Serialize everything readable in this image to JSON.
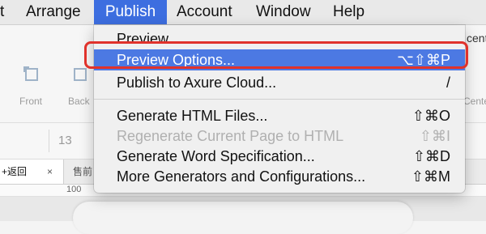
{
  "menubar": {
    "items": [
      {
        "label": "t"
      },
      {
        "label": "Arrange"
      },
      {
        "label": "Publish"
      },
      {
        "label": "Account"
      },
      {
        "label": "Window"
      },
      {
        "label": "Help"
      }
    ]
  },
  "toolbar": {
    "front_label": "Front",
    "back_label": "Back",
    "center_fragment": "cent",
    "center_label_fragment": "Cente"
  },
  "formatbar": {
    "font_size": "13"
  },
  "tabs": {
    "active": "+返回",
    "close": "×",
    "second": "售前"
  },
  "ruler": {
    "mark": "100"
  },
  "publish_menu": {
    "items": [
      {
        "label": "Preview",
        "shortcut": "",
        "state": "normal"
      },
      {
        "label": "Preview Options...",
        "shortcut": "⌥⇧⌘P",
        "state": "selected"
      },
      {
        "label": "Publish to Axure Cloud...",
        "shortcut": "/",
        "state": "normal"
      },
      {
        "label": "Generate HTML Files...",
        "shortcut": "⇧⌘O",
        "state": "normal"
      },
      {
        "label": "Regenerate Current Page to HTML",
        "shortcut": "⇧⌘I",
        "state": "disabled"
      },
      {
        "label": "Generate Word Specification...",
        "shortcut": "⇧⌘D",
        "state": "normal"
      },
      {
        "label": "More Generators and Configurations...",
        "shortcut": "⇧⌘M",
        "state": "normal"
      }
    ]
  },
  "colors": {
    "accent": "#3d6ee0",
    "selection": "#4c79e3",
    "highlight": "#e0322b"
  }
}
